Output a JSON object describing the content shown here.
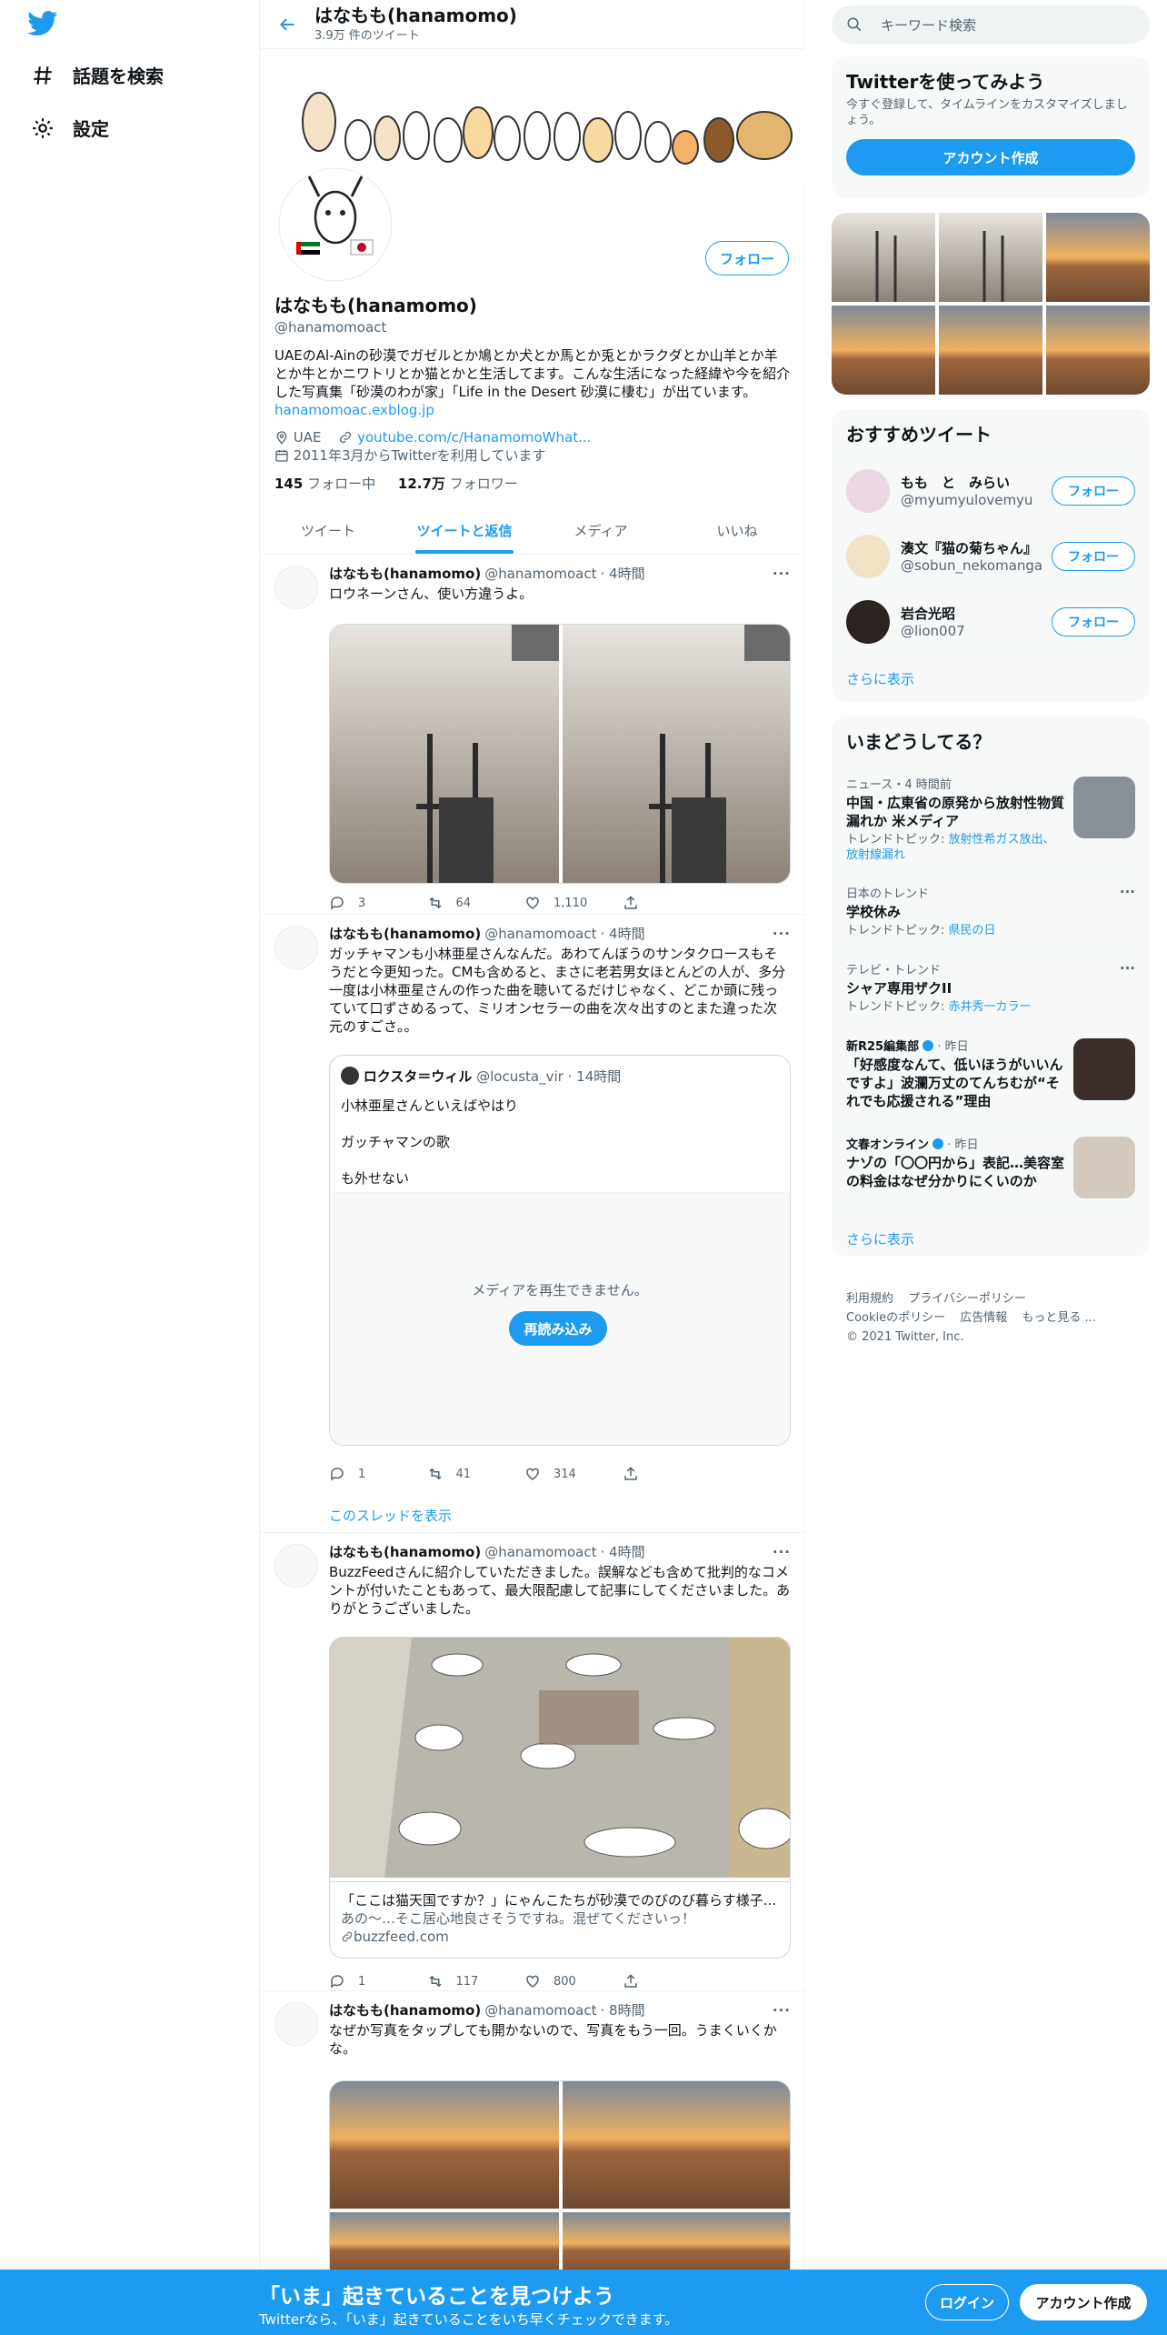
{
  "nav": {
    "items": [
      {
        "label": "話題を検索",
        "icon": "hashtag-icon"
      },
      {
        "label": "設定",
        "icon": "gear-icon"
      }
    ]
  },
  "header": {
    "title": "はなもも(hanamomo)",
    "subtitle": "3.9万 件のツイート"
  },
  "profile": {
    "name": "はなもも(hanamomo)",
    "handle": "@hanamomoact",
    "bio": "UAEのAl-Ainの砂漠でガゼルとか鳩とか犬とか馬とか兎とかラクダとか山羊とか羊とか牛とかニワトリとか猫とかと生活してます。こんな生活になった経緯や今を紹介した写真集「砂漠のわが家」「Life in the Desert 砂漠に棲む」が出ています。",
    "bio_link": "hanamomoac.exblog.jp",
    "location": "UAE",
    "website": "youtube.com/c/HanamomoWhat...",
    "joined": "2011年3月からTwitterを利用しています",
    "following_count": "145",
    "following_label": "フォロー中",
    "followers_count": "12.7万",
    "followers_label": "フォロワー",
    "follow_button": "フォロー"
  },
  "tabs": [
    "ツイート",
    "ツイートと返信",
    "メディア",
    "いいね"
  ],
  "active_tab": 1,
  "tweets": [
    {
      "name": "はなもも(hanamomo)",
      "handle": "@hanamomoact",
      "time": "· 4時間",
      "text": "ロウネーンさん、使い方違うよ。",
      "replies": "3",
      "retweets": "64",
      "likes": "1,110"
    },
    {
      "name": "はなもも(hanamomo)",
      "handle": "@hanamomoact",
      "time": "· 4時間",
      "text": "ガッチャマンも小林亜星さんなんだ。あわてんぼうのサンタクロースもそうだと今更知った。CMも含めると、まさに老若男女ほとんどの人が、多分一度は小林亜星さんの作った曲を聴いてるだけじゃなく、どこか頭に残っていて口ずさめるって、ミリオンセラーの曲を次々出すのとまた違った次元のすごさ。。",
      "quote": {
        "name": "ロクスタ＝ウィル",
        "handle": "@locusta_vir",
        "time": "· 14時間",
        "line1": "小林亜星さんといえばやはり",
        "line2": "ガッチャマンの歌",
        "line3": "も外せない",
        "media_error": "メディアを再生できません。",
        "reload": "再読み込み"
      },
      "replies": "1",
      "retweets": "41",
      "likes": "314",
      "thread_link": "このスレッドを表示"
    },
    {
      "name": "はなもも(hanamomo)",
      "handle": "@hanamomoact",
      "time": "· 4時間",
      "text": "BuzzFeedさんに紹介していただきました。誤解なども含めて批判的なコメントが付いたこともあって、最大限配慮して記事にしてくださいました。ありがとうございました。",
      "card": {
        "title": "「ここは猫天国ですか？」にゃんこたちが砂漠でのびのび暮らす様子...",
        "desc": "あの～…そこ居心地良さそうですね。混ぜてくださいっ！",
        "domain": "buzzfeed.com"
      },
      "replies": "1",
      "retweets": "117",
      "likes": "800"
    },
    {
      "name": "はなもも(hanamomo)",
      "handle": "@hanamomoact",
      "time": "· 8時間",
      "text": "なぜか写真をタップしても開かないので、写真をもう一回。うまくいくかな。"
    }
  ],
  "right": {
    "search_placeholder": "キーワード検索",
    "signup_card": {
      "title": "Twitterを使ってみよう",
      "desc": "今すぐ登録して、タイムラインをカスタマイズしましょう。",
      "button": "アカウント作成"
    },
    "who_to_follow": {
      "title": "おすすめツイート",
      "users": [
        {
          "name": "もも　と　みらい",
          "handle": "@myumyulovemyu"
        },
        {
          "name": "湊文『猫の菊ちゃん』",
          "handle": "@sobun_nekomanga"
        },
        {
          "name": "岩合光昭",
          "handle": "@lion007"
        }
      ],
      "follow_label": "フォロー",
      "show_more": "さらに表示"
    },
    "trends": {
      "title": "いまどうしてる？",
      "items": [
        {
          "meta": "ニュース・4 時間前",
          "title": "中国・広東省の原発から放射性物質漏れか 米メディア",
          "sub": "トレンドトピック: ",
          "sub_link": "放射性希ガス放出、放射線漏れ"
        },
        {
          "meta": "日本のトレンド",
          "title": "学校休み",
          "sub": "トレンドトピック: ",
          "sub_link": "県民の日"
        },
        {
          "meta": "テレビ・トレンド",
          "title": "シャア専用ザクII",
          "sub": "トレンドトピック: ",
          "sub_link": "赤井秀一カラー"
        },
        {
          "meta_source": "新R25編集部",
          "meta": "· 昨日",
          "title": "「好感度なんて、低いほうがいいんですよ」波瀾万丈のてんちむが“それでも応援される”理由"
        },
        {
          "meta_source": "文春オンライン",
          "meta": "· 昨日",
          "title": "ナゾの「〇〇円から」表記…美容室の料金はなぜ分かりにくいのか"
        }
      ],
      "show_more": "さらに表示"
    },
    "footer": {
      "links": [
        "利用規約",
        "プライバシーポリシー",
        "Cookieのポリシー",
        "広告情報",
        "もっと見る ..."
      ],
      "copyright": "© 2021 Twitter, Inc."
    }
  },
  "bottom_bar": {
    "title": "「いま」起きていることを見つけよう",
    "subtitle": "Twitterなら、「いま」起きていることをいち早くチェックできます。",
    "login": "ログイン",
    "signup": "アカウント作成"
  },
  "colors": {
    "accent": "#1d9bf0",
    "text": "#0f1419",
    "secondary": "#536471"
  }
}
